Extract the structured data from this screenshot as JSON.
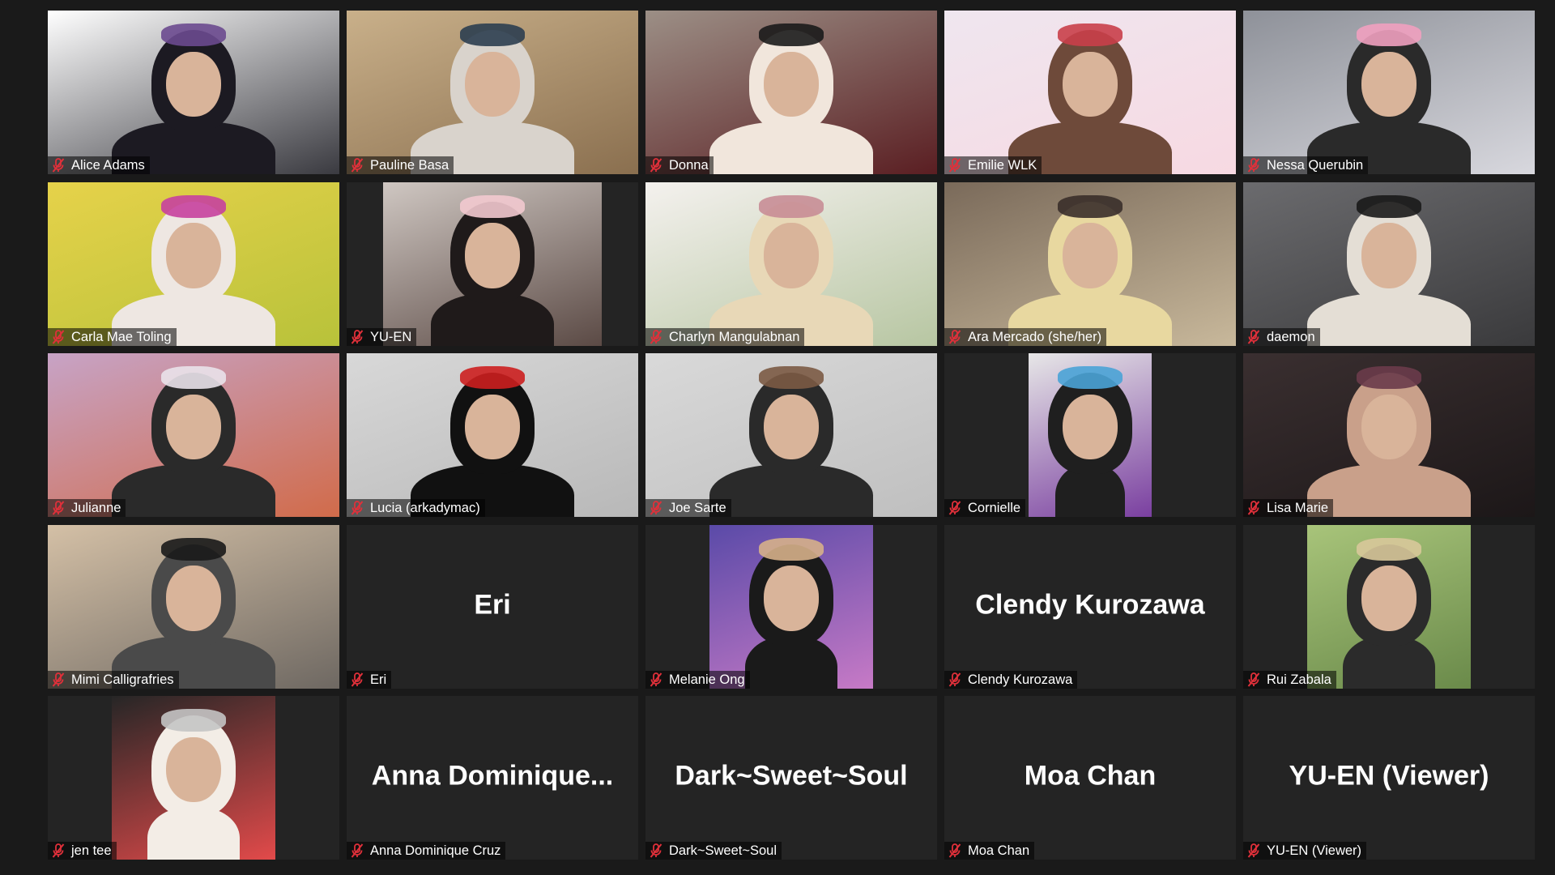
{
  "meeting": {
    "view": "gallery",
    "columns": 5,
    "rows": 5,
    "muted_color": "#e0303a"
  },
  "participants": [
    {
      "name": "Alice Adams",
      "video": "on",
      "muted": true,
      "frame": "full",
      "scene": [
        "#ffffff",
        "#3a3a40",
        "#1c1a22",
        "#6b4a8f"
      ]
    },
    {
      "name": "Pauline Basa",
      "video": "on",
      "muted": true,
      "frame": "full",
      "scene": [
        "#c9b08a",
        "#8a6f4f",
        "#d9d3cc",
        "#2c3e50"
      ]
    },
    {
      "name": "Donna",
      "video": "on",
      "muted": true,
      "frame": "full",
      "scene": [
        "#9c8f86",
        "#5a1e22",
        "#f1e6dc",
        "#1b1b1b"
      ]
    },
    {
      "name": "Emilie WLK",
      "video": "on",
      "muted": true,
      "frame": "full",
      "scene": [
        "#efe6ef",
        "#f7d9e2",
        "#6e4a3a",
        "#c93f4a"
      ]
    },
    {
      "name": "Nessa Querubin",
      "video": "on",
      "muted": true,
      "frame": "full",
      "scene": [
        "#8e9199",
        "#d8d8de",
        "#2a2a2a",
        "#f0a0bf"
      ]
    },
    {
      "name": "Carla Mae Toling",
      "video": "on",
      "muted": true,
      "frame": "full",
      "scene": [
        "#e6d24a",
        "#b8c23a",
        "#eee7e2",
        "#c7419f"
      ]
    },
    {
      "name": "YU-EN",
      "video": "on",
      "muted": true,
      "frame": "pillar",
      "scene": [
        "#cfc7c2",
        "#5b4a45",
        "#1f1a1a",
        "#f2c9cf"
      ]
    },
    {
      "name": "Charlyn Mangulabnan",
      "video": "on",
      "muted": true,
      "frame": "full",
      "scene": [
        "#f4f1ee",
        "#b7c6a2",
        "#e8d8b7",
        "#c88d96"
      ]
    },
    {
      "name": "Ara Mercado (she/her)",
      "video": "on",
      "muted": true,
      "frame": "full",
      "scene": [
        "#7a6a5a",
        "#c8b89b",
        "#e8d8a0",
        "#3a2f2a"
      ]
    },
    {
      "name": "daemon",
      "video": "on",
      "muted": true,
      "frame": "full",
      "scene": [
        "#6b6b6e",
        "#3a3a3c",
        "#e4ded5",
        "#1a1a1a"
      ]
    },
    {
      "name": "Julianne",
      "video": "on",
      "muted": true,
      "frame": "full",
      "scene": [
        "#c7a3c6",
        "#d16b4a",
        "#2a2a2a",
        "#e9e2ea"
      ]
    },
    {
      "name": "Lucia (arkadymac)",
      "video": "on",
      "muted": true,
      "frame": "full",
      "scene": [
        "#d8d8d8",
        "#b8b8b8",
        "#111111",
        "#cc1f1f"
      ]
    },
    {
      "name": "Joe Sarte",
      "video": "on",
      "muted": true,
      "frame": "full",
      "scene": [
        "#d9d9d9",
        "#bfbfbf",
        "#2a2a2a",
        "#7b5a44"
      ]
    },
    {
      "name": "Cornielle",
      "video": "on",
      "muted": true,
      "frame": "pillar",
      "scene": [
        "#e7e7e7",
        "#7a3fa0",
        "#1f1f1f",
        "#4aa3d6"
      ]
    },
    {
      "name": "Lisa Marie",
      "video": "on",
      "muted": true,
      "frame": "full",
      "scene": [
        "#3a2f30",
        "#1c1718",
        "#c9a08a",
        "#6a3b4a"
      ]
    },
    {
      "name": "Mimi Calligrafries",
      "video": "on",
      "muted": true,
      "frame": "full",
      "scene": [
        "#d4c0a6",
        "#6e6862",
        "#4a4a4a",
        "#1a1a1a"
      ]
    },
    {
      "name": "Eri",
      "video": "off",
      "muted": true,
      "frame": "none",
      "scene": []
    },
    {
      "name": "Melanie Ong",
      "video": "on",
      "muted": true,
      "frame": "pillar",
      "scene": [
        "#5a4aa8",
        "#c77ac6",
        "#1a1a1a",
        "#d6b08a"
      ]
    },
    {
      "name": "Clendy Kurozawa",
      "video": "off",
      "muted": true,
      "frame": "none",
      "scene": []
    },
    {
      "name": "Rui Zabala",
      "video": "on",
      "muted": true,
      "frame": "pillar",
      "scene": [
        "#a8c47a",
        "#6a8a4a",
        "#2b2b2b",
        "#d8c89a"
      ]
    },
    {
      "name": "jen tee",
      "video": "on",
      "muted": true,
      "frame": "pillar",
      "scene": [
        "#262626",
        "#e24a4a",
        "#f3ede6",
        "#c4c4c4"
      ]
    },
    {
      "name": "Anna Dominique Cruz",
      "avatar_text": "Anna  Dominique...",
      "video": "off",
      "muted": true,
      "frame": "none",
      "scene": []
    },
    {
      "name": "Dark~Sweet~Soul",
      "video": "off",
      "muted": true,
      "frame": "none",
      "scene": []
    },
    {
      "name": "Moa Chan",
      "video": "off",
      "muted": true,
      "frame": "none",
      "scene": []
    },
    {
      "name": "YU-EN (Viewer)",
      "video": "off",
      "muted": true,
      "frame": "none",
      "scene": []
    }
  ]
}
